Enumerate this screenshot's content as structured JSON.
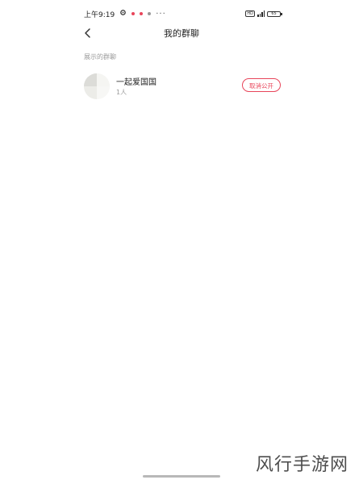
{
  "status_bar": {
    "time": "上午9:19",
    "more": "···",
    "battery_label": "65",
    "network_label": "HD"
  },
  "header": {
    "title": "我的群聊"
  },
  "section": {
    "label": "展示的群聊"
  },
  "groups": [
    {
      "name": "一起爱国国",
      "member_count": "1人",
      "action_label": "取消公开"
    }
  ],
  "watermark": "风行手游网",
  "colors": {
    "accent": "#e8455a",
    "text_primary": "#222222",
    "text_secondary": "#9a9a9a"
  }
}
